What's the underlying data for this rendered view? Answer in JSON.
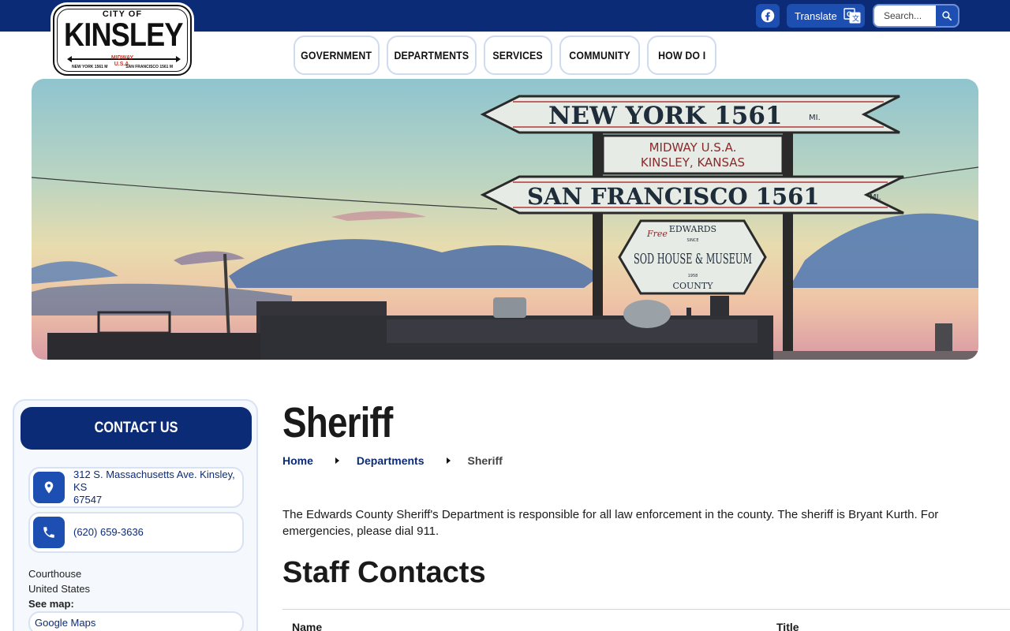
{
  "topbar": {
    "translate_label": "Translate",
    "search_placeholder": "Search...",
    "colors": {
      "bar": "#0c2b77",
      "button": "#1d4fb3"
    }
  },
  "logo": {
    "city_of": "CITY OF",
    "name": "KINSLEY",
    "midway": "MIDWAY",
    "usa": "U.S.A.",
    "left_text": "NEW YORK 1561 M",
    "right_text": "SAN FRANCISCO 1561 M"
  },
  "nav": {
    "items": [
      {
        "label": "GOVERNMENT"
      },
      {
        "label": "DEPARTMENTS"
      },
      {
        "label": "SERVICES"
      },
      {
        "label": "COMMUNITY"
      },
      {
        "label": "HOW DO I"
      }
    ]
  },
  "hero": {
    "sign_top": "NEW YORK 1561",
    "sign_top_unit": "MI.",
    "sign_mid_1": "MIDWAY U.S.A.",
    "sign_mid_2": "KINSLEY, KANSAS",
    "sign_bottom": "SAN FRANCISCO 1561",
    "sign_bottom_unit": "MI.",
    "museum_free": "Free",
    "museum_top": "EDWARDS",
    "museum_since": "SINCE",
    "museum_main": "SOD HOUSE & MUSEUM",
    "museum_year": "1958",
    "museum_bottom": "COUNTY"
  },
  "sidebar": {
    "contact_title": "CONTACT US",
    "address_line1": "312 S. Massachusetts Ave. Kinsley, KS",
    "address_line2": "67547",
    "phone": "(620) 659-3636",
    "place_line1": "Courthouse",
    "place_line2": "United States",
    "see_map_label": "See map:",
    "map_link": "Google Maps"
  },
  "main": {
    "title": "Sheriff",
    "breadcrumb": [
      "Home",
      "Departments",
      "Sheriff"
    ],
    "intro": "The Edwards County Sheriff's Department is responsible for all law enforcement in the county. The sheriff is Bryant Kurth. For emergencies, please dial 911.",
    "section_title": "Staff Contacts",
    "table_headers": [
      "Name",
      "Title"
    ]
  }
}
